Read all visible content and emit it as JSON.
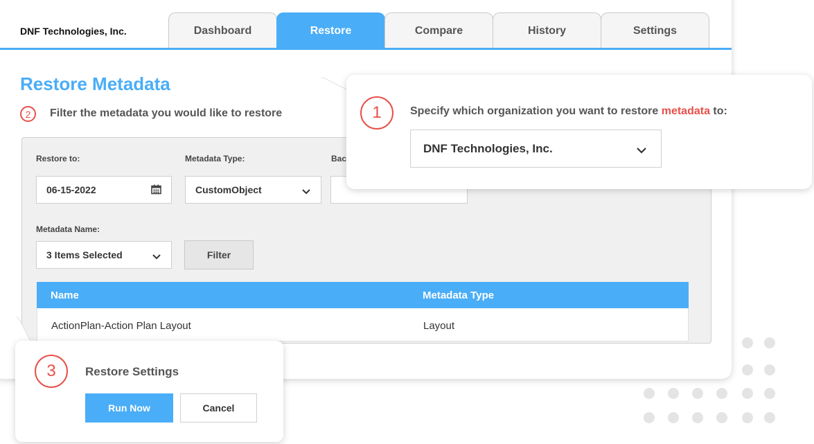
{
  "header": {
    "org_name": "DNF Technologies, Inc.",
    "tabs": [
      {
        "label": "Dashboard",
        "active": false
      },
      {
        "label": "Restore",
        "active": true
      },
      {
        "label": "Compare",
        "active": false
      },
      {
        "label": "History",
        "active": false
      },
      {
        "label": "Settings",
        "active": false
      }
    ]
  },
  "page": {
    "title": "Restore Metadata",
    "step2_number": "2",
    "step2_text": "Filter the metadata you would like to restore"
  },
  "filters": {
    "restore_to_label": "Restore to:",
    "restore_to_value": "06-15-2022",
    "metadata_type_label": "Metadata Type:",
    "metadata_type_value": "CustomObject",
    "backup_label_partial": "Bac",
    "metadata_name_label": "Metadata Name:",
    "metadata_name_value": "3 Items Selected",
    "filter_button": "Filter"
  },
  "table": {
    "columns": [
      "Name",
      "Metadata Type"
    ],
    "rows": [
      [
        "ActionPlan-Action Plan Layout",
        "Layout"
      ]
    ]
  },
  "callout1": {
    "step_number": "1",
    "text_before": "Specify which organization you want to restore ",
    "text_highlight": "metadata",
    "text_after": " to:",
    "org_select_value": "DNF Technologies, Inc."
  },
  "callout3": {
    "step_number": "3",
    "title": "Restore Settings",
    "run_button": "Run Now",
    "cancel_button": "Cancel"
  },
  "colors": {
    "accent": "#4aadf7",
    "step": "#e8504a",
    "panel": "#f0f0f0"
  },
  "icons": [
    "calendar-icon",
    "chevron-down-icon"
  ]
}
